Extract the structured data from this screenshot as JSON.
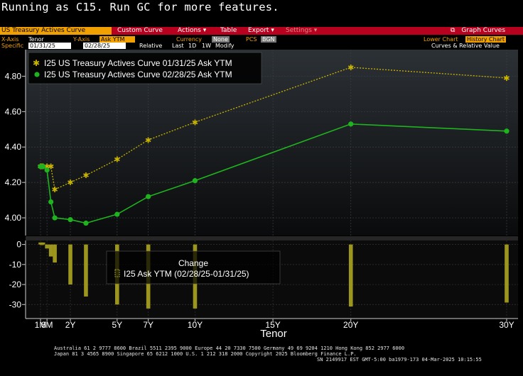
{
  "terminal": {
    "message": "Running as C15.  Run GC for more features."
  },
  "menubar": {
    "title": "US Treasury Actives Curve",
    "items": [
      "Custom Curve",
      "Actions ▾",
      "Table",
      "Export ▾",
      "Settings ▾"
    ],
    "graph_curves_label": "Graph Curves"
  },
  "controls": {
    "xaxis_label": "X-Axis",
    "xaxis_value": "Tenor",
    "yaxis_label": "Y-Axis",
    "yaxis_value": "Ask YTM",
    "currency_label": "Currency",
    "currency_value": "None",
    "pcs_label": "PCS",
    "pcs_value": "BGN",
    "lower_chart_label": "Lower Chart",
    "lower_chart_value": "History Chart",
    "specific_label": "Specific",
    "date1": "01/31/25",
    "date2": "02/28/25",
    "relative_label": "Relative",
    "last": "Last",
    "d1": "1D",
    "w1": "1W",
    "modify": "Modify",
    "curves_rel_label": "Curves & Relative Value"
  },
  "colors": {
    "series1": "#c8b400",
    "series2": "#1fb31f",
    "bars": "#9c961e",
    "menu": "#b8001f",
    "accent": "#f0a000"
  },
  "legend_upper": [
    {
      "marker": "star",
      "label": "I25 US Treasury Actives Curve 01/31/25 Ask YTM"
    },
    {
      "marker": "dot",
      "label": "I25 US Treasury Actives Curve 02/28/25 Ask YTM"
    }
  ],
  "legend_lower": {
    "title": "Change",
    "label": "I25 Ask YTM (02/28/25-01/31/25)"
  },
  "chart_data": {
    "type": "line",
    "xlabel": "Tenor",
    "x_ticks": [
      {
        "label": "1M",
        "t": 0.083
      },
      {
        "label": "6M",
        "t": 0.5
      },
      {
        "label": "2Y",
        "t": 2
      },
      {
        "label": "5Y",
        "t": 5
      },
      {
        "label": "7Y",
        "t": 7
      },
      {
        "label": "10Y",
        "t": 10
      },
      {
        "label": "15Y",
        "t": 15
      },
      {
        "label": "20Y",
        "t": 20
      },
      {
        "label": "30Y",
        "t": 30
      }
    ],
    "x_tenors": [
      0.083,
      0.167,
      0.25,
      0.5,
      0.75,
      1,
      2,
      3,
      5,
      7,
      10,
      20,
      30
    ],
    "upper": {
      "ylim": [
        3.9,
        4.95
      ],
      "yticks": [
        4.0,
        4.2,
        4.4,
        4.6,
        4.8
      ],
      "ytick_labels": [
        "4.00",
        "4.20",
        "4.40",
        "4.60",
        "4.80"
      ],
      "series": [
        {
          "name": "I25 US Treasury Actives Curve 01/31/25 Ask YTM",
          "values": [
            4.29,
            4.29,
            4.29,
            4.29,
            4.29,
            4.16,
            4.2,
            4.24,
            4.33,
            4.44,
            4.54,
            4.85,
            4.79
          ]
        },
        {
          "name": "I25 US Treasury Actives Curve 02/28/25 Ask YTM",
          "values": [
            4.29,
            4.29,
            4.29,
            4.27,
            4.09,
            4.0,
            3.99,
            3.97,
            4.02,
            4.12,
            4.21,
            4.53,
            4.49
          ]
        }
      ]
    },
    "lower": {
      "type": "bar",
      "ylim": [
        -37,
        2
      ],
      "yticks": [
        0,
        -10,
        -20,
        -30
      ],
      "ytick_labels": [
        "0",
        "-10",
        "-20",
        "-30"
      ],
      "values": [
        1,
        0,
        1,
        -2,
        -6,
        -9,
        -20,
        -26,
        -30,
        -32,
        -32,
        -31,
        -29
      ]
    }
  },
  "footer": {
    "line1": "Australia 61 2 9777 8600 Brazil 5511 2395 9000 Europe 44 20 7330 7500 Germany 49 69 9204 1210 Hong Kong 852 2977 6000",
    "line2": "Japan 81 3 4565 8900        Singapore 65 6212 1000       U.S. 1 212 318 2000           Copyright 2025 Bloomberg Finance L.P.",
    "line3": "SN 2149917 EST  GMT-5:00 ba1979-173 04-Mar-2025 10:15:55"
  }
}
